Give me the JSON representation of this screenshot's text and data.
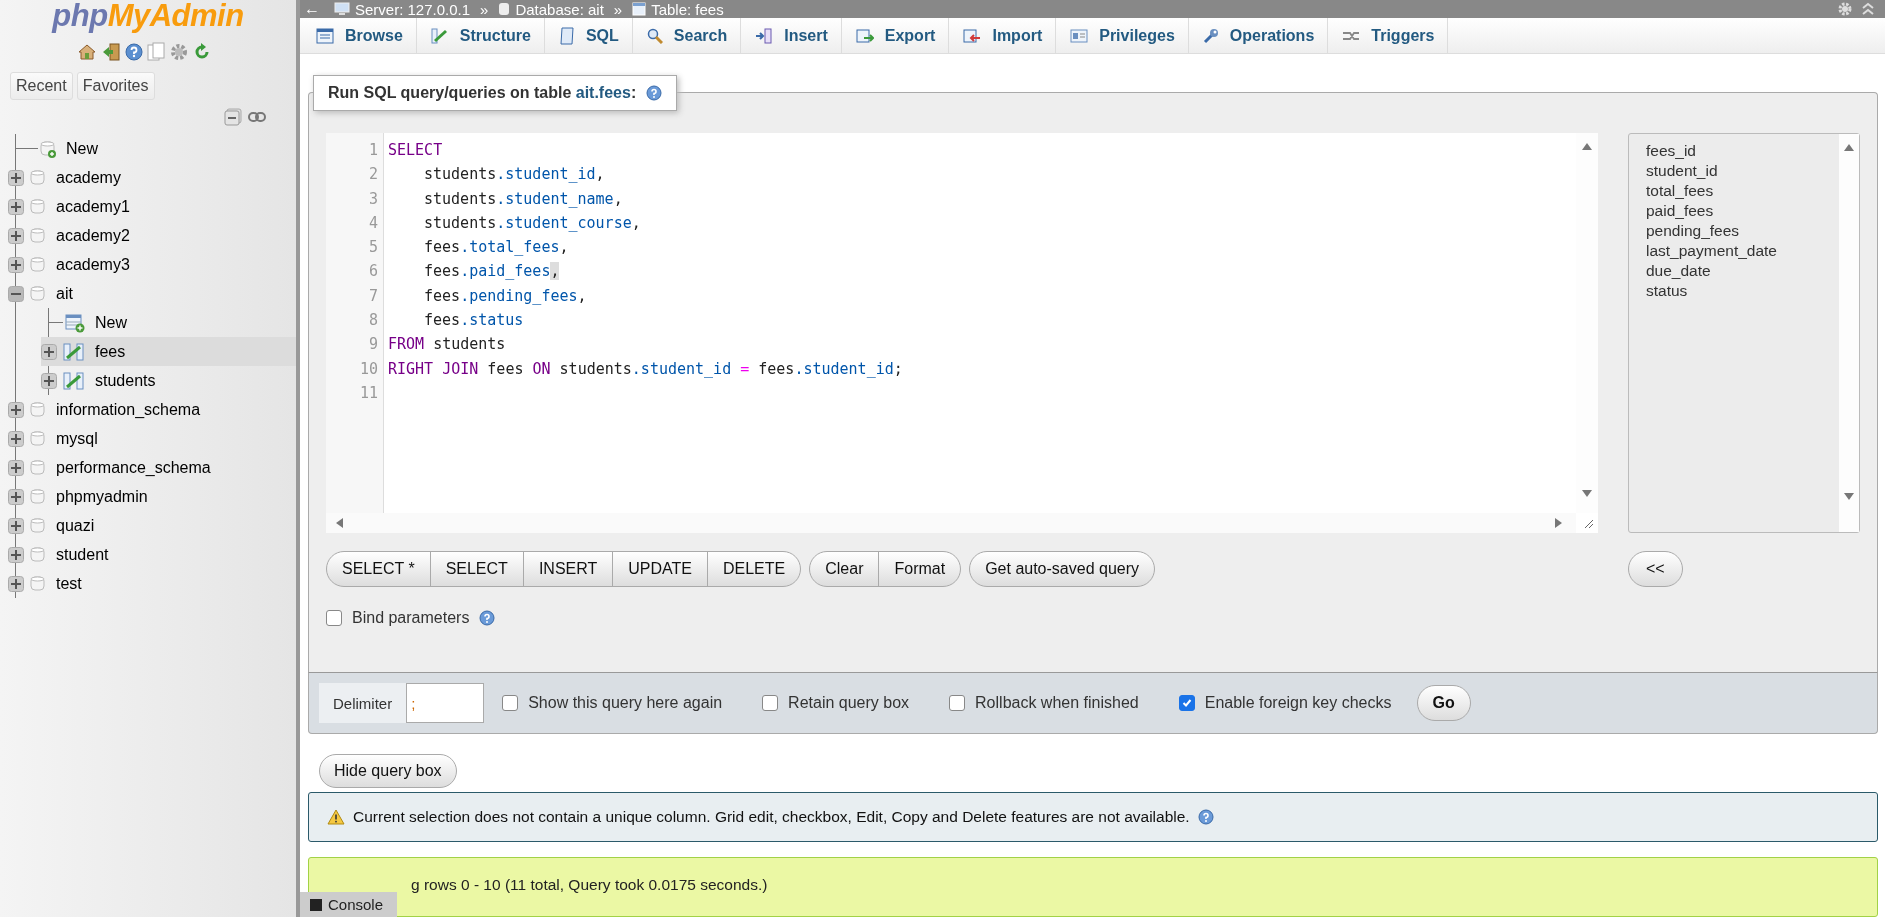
{
  "logo": {
    "text_a": "php",
    "text_b": "MyAdmin"
  },
  "nav_buttons": [
    {
      "label": "Recent"
    },
    {
      "label": "Favorites"
    }
  ],
  "tree": [
    {
      "kind": "new",
      "label": "New",
      "selected": false
    },
    {
      "kind": "database",
      "label": "academy",
      "expanded": false,
      "selected": false
    },
    {
      "kind": "database",
      "label": "academy1",
      "expanded": false,
      "selected": false
    },
    {
      "kind": "database",
      "label": "academy2",
      "expanded": false,
      "selected": false
    },
    {
      "kind": "database",
      "label": "academy3",
      "expanded": false,
      "selected": false
    },
    {
      "kind": "database",
      "label": "ait",
      "expanded": true,
      "selected": false,
      "children": [
        {
          "kind": "new",
          "label": "New",
          "selected": false
        },
        {
          "kind": "table",
          "label": "fees",
          "expanded": false,
          "selected": true
        },
        {
          "kind": "table",
          "label": "students",
          "expanded": false,
          "selected": false
        }
      ]
    },
    {
      "kind": "database",
      "label": "information_schema",
      "expanded": false,
      "selected": false
    },
    {
      "kind": "database",
      "label": "mysql",
      "expanded": false,
      "selected": false
    },
    {
      "kind": "database",
      "label": "performance_schema",
      "expanded": false,
      "selected": false
    },
    {
      "kind": "database",
      "label": "phpmyadmin",
      "expanded": false,
      "selected": false
    },
    {
      "kind": "database",
      "label": "quazi",
      "expanded": false,
      "selected": false
    },
    {
      "kind": "database",
      "label": "student",
      "expanded": false,
      "selected": false
    },
    {
      "kind": "database",
      "label": "test",
      "expanded": false,
      "selected": false
    }
  ],
  "back": "←",
  "breadcrumb": [
    {
      "kind": "server",
      "label": "Server: 127.0.0.1"
    },
    {
      "kind": "separator",
      "label": "»"
    },
    {
      "kind": "database",
      "label": "Database: ait"
    },
    {
      "kind": "separator",
      "label": "»"
    },
    {
      "kind": "table",
      "label": "Table: fees"
    }
  ],
  "tabs": [
    {
      "kind": "browse",
      "label": "Browse"
    },
    {
      "kind": "structure",
      "label": "Structure"
    },
    {
      "kind": "sql",
      "label": "SQL"
    },
    {
      "kind": "search",
      "label": "Search"
    },
    {
      "kind": "insert",
      "label": "Insert"
    },
    {
      "kind": "export",
      "label": "Export"
    },
    {
      "kind": "import",
      "label": "Import"
    },
    {
      "kind": "privileges",
      "label": "Privileges"
    },
    {
      "kind": "operations",
      "label": "Operations"
    },
    {
      "kind": "triggers",
      "label": "Triggers"
    }
  ],
  "query_panel": {
    "legend_prefix": "Run SQL query/queries on table ",
    "legend_link": "ait.fees",
    "legend_suffix": ":"
  },
  "code_lines": [
    {
      "number": "1",
      "indent": false,
      "tokens": [
        {
          "kind": "keyword",
          "text": "SELECT"
        }
      ]
    },
    {
      "number": "2",
      "indent": true,
      "tokens": [
        {
          "kind": "plain",
          "text": "students"
        },
        {
          "kind": "field",
          "text": ".student_id"
        },
        {
          "kind": "plain",
          "text": ","
        }
      ]
    },
    {
      "number": "3",
      "indent": true,
      "tokens": [
        {
          "kind": "plain",
          "text": "students"
        },
        {
          "kind": "field",
          "text": ".student_name"
        },
        {
          "kind": "plain",
          "text": ","
        }
      ]
    },
    {
      "number": "4",
      "indent": true,
      "tokens": [
        {
          "kind": "plain",
          "text": "students"
        },
        {
          "kind": "field",
          "text": ".student_course"
        },
        {
          "kind": "plain",
          "text": ","
        }
      ]
    },
    {
      "number": "5",
      "indent": true,
      "tokens": [
        {
          "kind": "plain",
          "text": "fees"
        },
        {
          "kind": "field",
          "text": ".total_fees"
        },
        {
          "kind": "plain",
          "text": ","
        }
      ]
    },
    {
      "number": "6",
      "indent": true,
      "tokens": [
        {
          "kind": "plain",
          "text": "fees"
        },
        {
          "kind": "field",
          "text": ".paid_fees"
        },
        {
          "kind": "highlight",
          "text": ","
        }
      ]
    },
    {
      "number": "7",
      "indent": true,
      "tokens": [
        {
          "kind": "plain",
          "text": "fees"
        },
        {
          "kind": "field",
          "text": ".pending_fees"
        },
        {
          "kind": "plain",
          "text": ","
        }
      ]
    },
    {
      "number": "8",
      "indent": true,
      "tokens": [
        {
          "kind": "plain",
          "text": "fees"
        },
        {
          "kind": "field",
          "text": ".status"
        }
      ]
    },
    {
      "number": "9",
      "indent": false,
      "tokens": [
        {
          "kind": "keyword",
          "text": "FROM"
        },
        {
          "kind": "plain",
          "text": " students"
        }
      ]
    },
    {
      "number": "10",
      "indent": false,
      "tokens": [
        {
          "kind": "keyword",
          "text": "RIGHT JOIN"
        },
        {
          "kind": "plain",
          "text": " fees "
        },
        {
          "kind": "keyword",
          "text": "ON"
        },
        {
          "kind": "plain",
          "text": " students"
        },
        {
          "kind": "field",
          "text": ".student_id"
        },
        {
          "kind": "operator",
          "text": " = "
        },
        {
          "kind": "plain",
          "text": "fees"
        },
        {
          "kind": "field",
          "text": ".student_id"
        },
        {
          "kind": "plain",
          "text": ";"
        }
      ]
    },
    {
      "number": "11",
      "indent": false
    }
  ],
  "columns": [
    "fees_id",
    "student_id",
    "total_fees",
    "paid_fees",
    "pending_fees",
    "last_payment_date",
    "due_date",
    "status"
  ],
  "insert_button": "<<",
  "query_button_groups": [
    [
      "SELECT *",
      "SELECT",
      "INSERT",
      "UPDATE",
      "DELETE"
    ],
    [
      "Clear",
      "Format"
    ],
    [
      "Get auto-saved query"
    ]
  ],
  "bind_parameters": {
    "label": "Bind parameters",
    "checked": false
  },
  "delimiter": {
    "label": "Delimiter",
    "value": ";"
  },
  "options": [
    {
      "label": "Show this query here again",
      "checked": false
    },
    {
      "label": "Retain query box",
      "checked": false
    },
    {
      "label": "Rollback when finished",
      "checked": false
    },
    {
      "label": "Enable foreign key checks",
      "checked": true
    }
  ],
  "go_button": "Go",
  "hide_button": "Hide query box",
  "notice": "Current selection does not contain a unique column. Grid edit, checkbox, Edit, Copy and Delete features are not available.",
  "success": "g rows 0 - 10 (11 total, Query took 0.0175 seconds.)",
  "console": "Console"
}
